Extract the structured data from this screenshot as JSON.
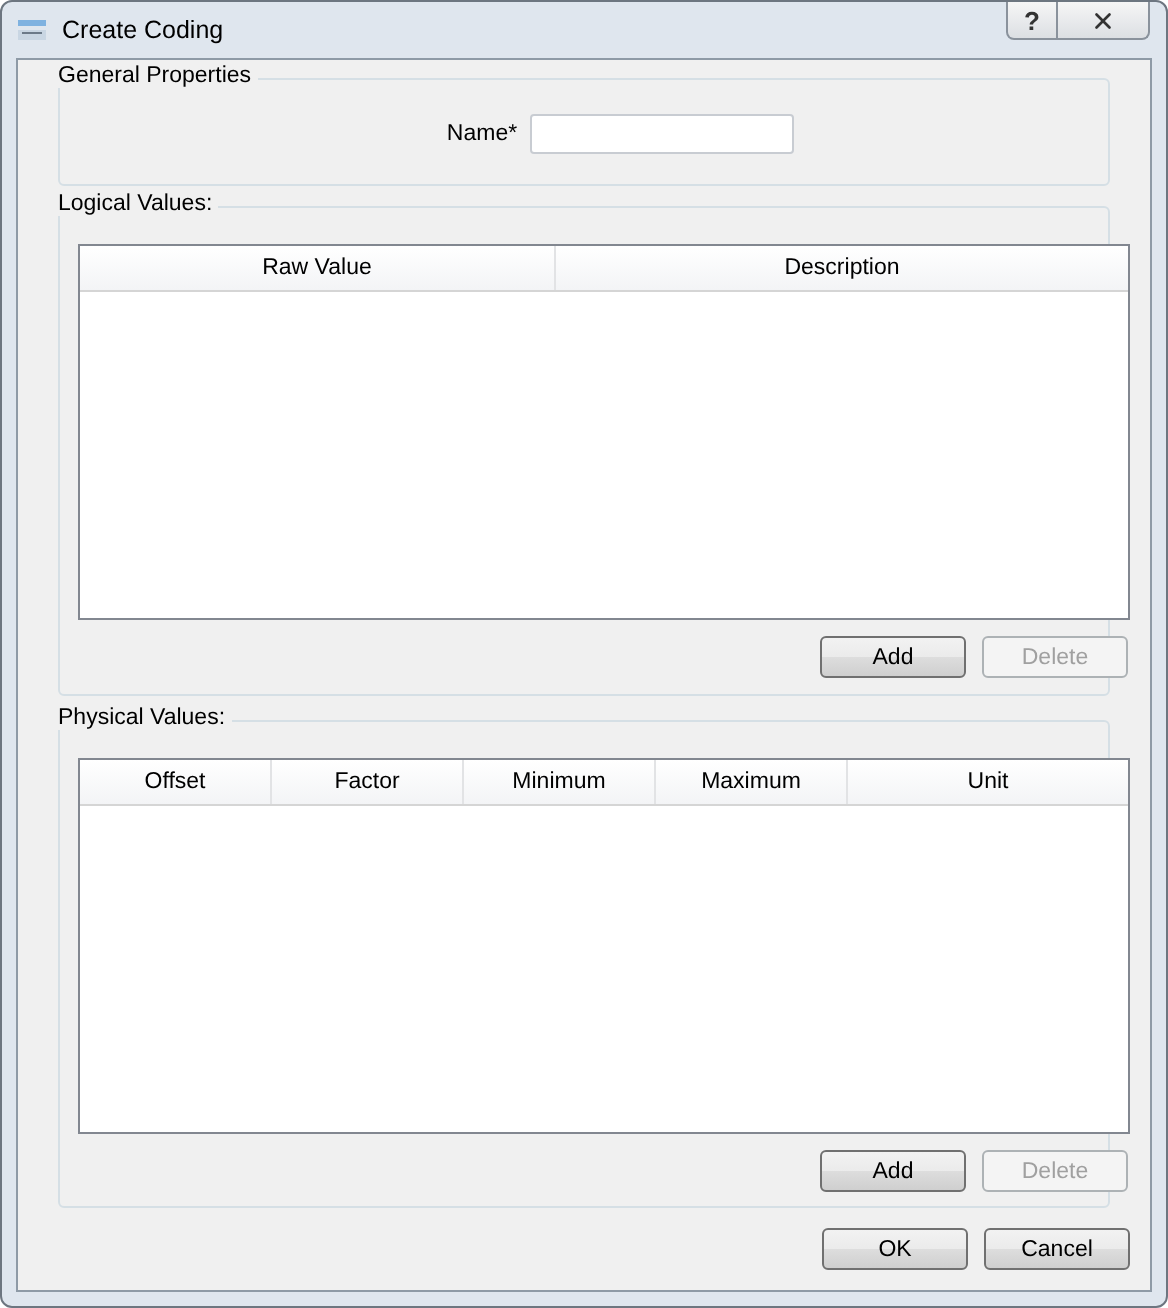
{
  "window": {
    "title": "Create Coding",
    "help_button": "?"
  },
  "general_properties": {
    "title": "General Properties",
    "name_label": "Name*"
  },
  "logical_values": {
    "title": "Logical Values:",
    "columns": [
      "Raw Value",
      "Description"
    ],
    "buttons": [
      {
        "label": "Add",
        "disabled": false
      },
      {
        "label": "Delete",
        "disabled": true
      }
    ]
  },
  "physical_values": {
    "title": "Physical Values:",
    "columns": [
      "Offset",
      "Factor",
      "Minimum",
      "Maximum",
      "Unit"
    ],
    "buttons": [
      {
        "label": "Add",
        "disabled": false
      },
      {
        "label": "Delete",
        "disabled": true
      }
    ]
  },
  "dialog_buttons": [
    {
      "label": "OK",
      "disabled": false
    },
    {
      "label": "Cancel",
      "disabled": false
    }
  ]
}
